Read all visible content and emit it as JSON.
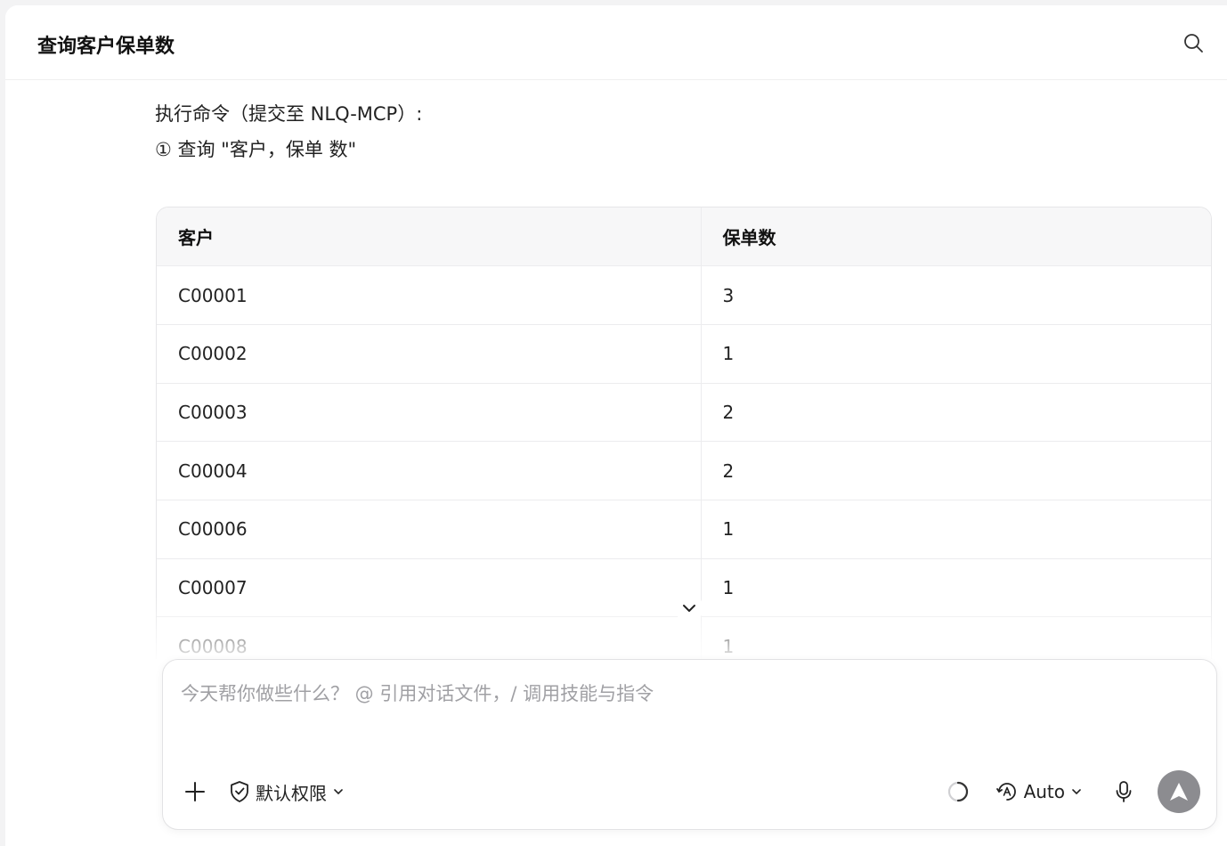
{
  "header": {
    "title": "查询客户保单数"
  },
  "message": {
    "line1": "执行命令（提交至 NLQ-MCP）:",
    "line2": "① 查询 \"客户，保单 数\""
  },
  "table": {
    "columns": [
      "客户",
      "保单数"
    ],
    "rows": [
      [
        "C00001",
        "3"
      ],
      [
        "C00002",
        "1"
      ],
      [
        "C00003",
        "2"
      ],
      [
        "C00004",
        "2"
      ],
      [
        "C00006",
        "1"
      ],
      [
        "C00007",
        "1"
      ],
      [
        "C00008",
        "1"
      ]
    ]
  },
  "composer": {
    "placeholder": "今天帮你做些什么？ @ 引用对话文件，/ 调用技能与指令",
    "permission_label": "默认权限",
    "model_label": "Auto"
  },
  "icons": {
    "search": "search-icon",
    "add": "plus-icon",
    "permission": "shield-check-icon",
    "loading": "spinner-icon",
    "model": "auto-model-icon",
    "mic": "microphone-icon",
    "send": "send-arrow-icon",
    "scroll": "chevron-down-icon"
  },
  "colors": {
    "send_button": "#8c8c90",
    "border": "#e6e6e8"
  }
}
